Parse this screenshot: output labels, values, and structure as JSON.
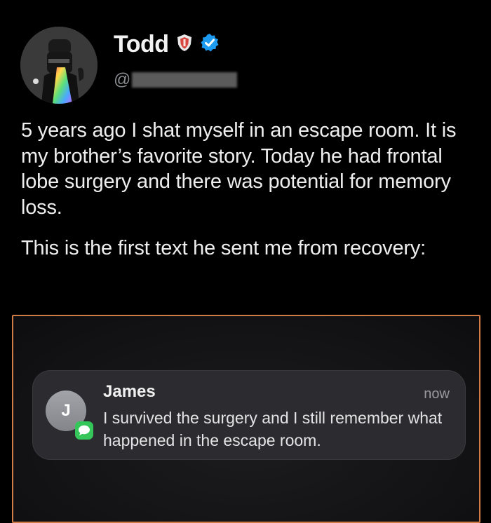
{
  "user": {
    "display_name": "Todd",
    "handle_prefix": "@",
    "badges": [
      "shield-badge-icon",
      "verified-badge-icon"
    ],
    "verified_color": "#1d9bf0"
  },
  "tweet": {
    "paragraphs": [
      "5 years ago I shat myself in an escape room. It is my brother’s favorite story. Today he had frontal lobe surgery and there was potential for memory loss.",
      "This is the first text he sent me from recovery:"
    ]
  },
  "notification": {
    "avatar_initial": "J",
    "sender": "James",
    "time": "now",
    "body": "I survived the surgery and I still remember what happened in the escape room.",
    "app_icon": "messages-icon",
    "app_color": "#35c65a"
  },
  "media_border_color": "#d07a45"
}
